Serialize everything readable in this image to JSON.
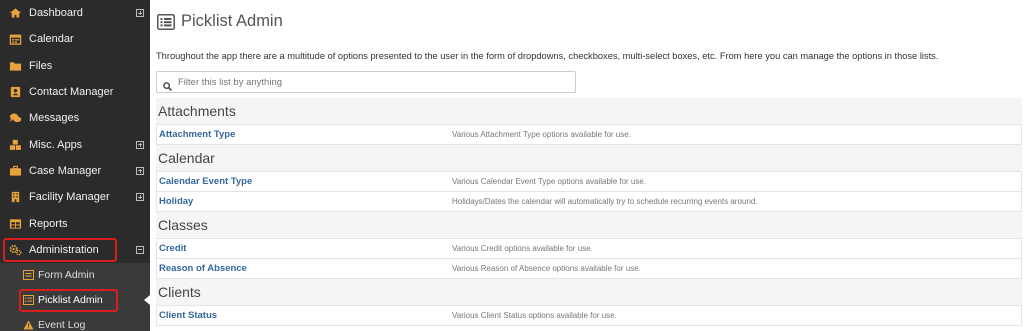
{
  "sidebar": {
    "items": [
      {
        "label": "Dashboard",
        "icon": "home-icon",
        "expander": "plus"
      },
      {
        "label": "Calendar",
        "icon": "calendar-icon",
        "expander": ""
      },
      {
        "label": "Files",
        "icon": "folder-icon",
        "expander": ""
      },
      {
        "label": "Contact Manager",
        "icon": "address-book-icon",
        "expander": ""
      },
      {
        "label": "Messages",
        "icon": "comments-icon",
        "expander": ""
      },
      {
        "label": "Misc. Apps",
        "icon": "cubes-icon",
        "expander": "plus"
      },
      {
        "label": "Case Manager",
        "icon": "briefcase-icon",
        "expander": "plus"
      },
      {
        "label": "Facility Manager",
        "icon": "building-icon",
        "expander": "plus"
      },
      {
        "label": "Reports",
        "icon": "table-icon",
        "expander": ""
      },
      {
        "label": "Administration",
        "icon": "cogs-icon",
        "expander": "minus"
      }
    ],
    "sub_items": [
      {
        "label": "Form Admin",
        "icon": "form-icon"
      },
      {
        "label": "Picklist Admin",
        "icon": "list-icon"
      },
      {
        "label": "Event Log",
        "icon": "warning-icon"
      }
    ],
    "accent_highlight": "#d81e1e"
  },
  "page": {
    "title": "Picklist Admin",
    "intro": "Throughout the app there are a multitude of options presented to the user in the form of dropdowns, checkboxes, multi-select boxes, etc. From here you can manage the options in those lists.",
    "search_placeholder": "Filter this list by anything"
  },
  "sections": [
    {
      "title": "Attachments",
      "rows": [
        {
          "name": "Attachment Type",
          "desc": "Various Attachment Type options available for use."
        }
      ]
    },
    {
      "title": "Calendar",
      "rows": [
        {
          "name": "Calendar Event Type",
          "desc": "Various Calendar Event Type options available for use."
        },
        {
          "name": "Holiday",
          "desc": "Holidays/Dates the calendar will automatically try to schedule recurring events around."
        }
      ]
    },
    {
      "title": "Classes",
      "rows": [
        {
          "name": "Credit",
          "desc": "Various Credit options available for use."
        },
        {
          "name": "Reason of Absence",
          "desc": "Various Reason of Absence options available for use."
        }
      ]
    },
    {
      "title": "Clients",
      "rows": [
        {
          "name": "Client Status",
          "desc": "Various Client Status options available for use."
        }
      ]
    }
  ]
}
